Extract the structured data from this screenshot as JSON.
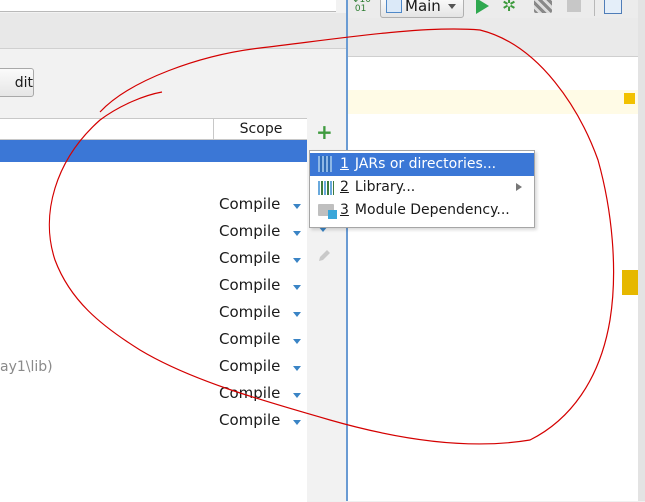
{
  "toolbar": {
    "run_config": "Main",
    "icons": [
      "make-project-icon",
      "run-config-icon",
      "run-icon",
      "debug-icon",
      "run-with-coverage-icon",
      "stop-icon",
      "project-structure-icon"
    ]
  },
  "dialog": {
    "edit_button": "dit",
    "table": {
      "scope_header": "Scope",
      "rows": [
        {
          "scope": "Compile"
        },
        {
          "scope": "Compile"
        },
        {
          "scope": "Compile"
        },
        {
          "scope": "Compile"
        },
        {
          "scope": "Compile"
        },
        {
          "scope": "Compile"
        },
        {
          "scope": "Compile"
        },
        {
          "scope": "Compile"
        },
        {
          "scope": "Compile"
        }
      ],
      "partial_path": "ay1\\lib)"
    },
    "side_tools": [
      "add-icon",
      "move-down-icon",
      "edit-icon"
    ]
  },
  "popup": {
    "items": [
      {
        "number": "1",
        "label": "JARs or directories...",
        "icon": "jar-icon",
        "selected": true
      },
      {
        "number": "2",
        "label": "Library...",
        "icon": "library-icon",
        "submenu": true
      },
      {
        "number": "3",
        "label": "Module Dependency...",
        "icon": "module-icon"
      }
    ]
  },
  "colors": {
    "selection": "#3b77d6",
    "add_icon": "#3f9b3f",
    "annotation": "#d40000",
    "marker": "#f2c100"
  }
}
